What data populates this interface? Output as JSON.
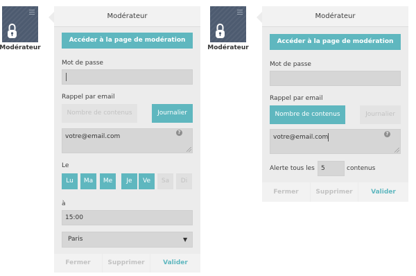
{
  "moderator_label": "Modérateur",
  "left_panel": {
    "title": "Modérateur",
    "moderation_button": "Accéder à la page de modération",
    "password_label": "Mot de passe",
    "password_value": "",
    "email_reminder_label": "Rappel par email",
    "count_option": "Nombre de contenus",
    "daily_option": "Journalier",
    "email_value": "votre@email.com",
    "help_glyph": "?",
    "days_label": "Le",
    "days": [
      {
        "label": "Lu",
        "selected": true
      },
      {
        "label": "Ma",
        "selected": true
      },
      {
        "label": "Me",
        "selected": true
      },
      {
        "label": "Je",
        "selected": true
      },
      {
        "label": "Ve",
        "selected": true
      },
      {
        "label": "Sa",
        "selected": false
      },
      {
        "label": "Di",
        "selected": false
      }
    ],
    "at_label": "à",
    "time_value": "15:00",
    "timezone_value": "Paris",
    "dropdown_glyph": "▼",
    "footer": {
      "close": "Fermer",
      "delete": "Supprimer",
      "validate": "Valider"
    }
  },
  "right_panel": {
    "title": "Modérateur",
    "moderation_button": "Accéder à la page de modération",
    "password_label": "Mot de passe",
    "password_value": "",
    "email_reminder_label": "Rappel par email",
    "count_option": "Nombre de contenus",
    "daily_option": "Journalier",
    "email_value": "votre@email.com",
    "help_glyph": "?",
    "alert_prefix": "Alerte tous les",
    "alert_value": "5",
    "alert_suffix": "contenus",
    "footer": {
      "close": "Fermer",
      "delete": "Supprimer",
      "validate": "Valider"
    }
  },
  "colors": {
    "accent": "#5fb7bf",
    "tile": "#4d5b70",
    "panel": "#ececec"
  }
}
